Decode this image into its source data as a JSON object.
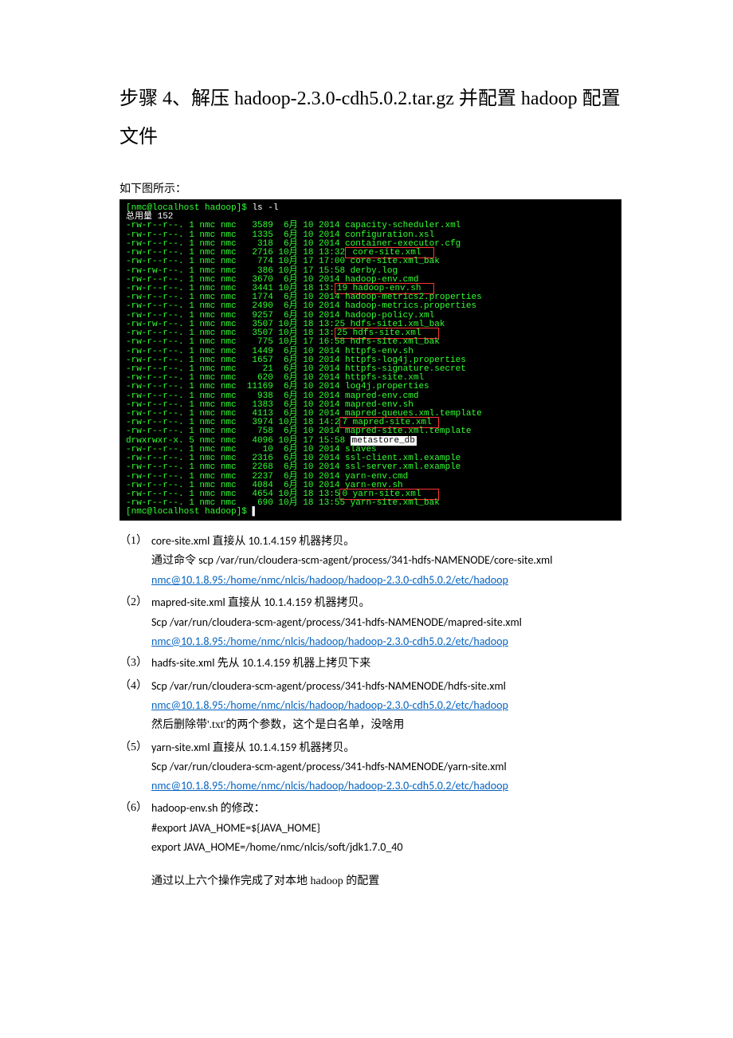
{
  "title": "步骤 4、解压 hadoop-2.3.0-cdh5.0.2.tar.gz  并配置 hadoop 配置文件",
  "intro": "如下图所示：",
  "terminal": {
    "line1a": "[nmc@localhost hadoop]$ ",
    "line1b": "ls -l",
    "total": "总用量 152",
    "rows_before_core": [
      "-rw-r--r--. 1 nmc nmc   3589  6月 10 2014 capacity-scheduler.xml",
      "-rw-r--r--. 1 nmc nmc   1335  6月 10 2014 configuration.xsl",
      "-rw-r--r--. 1 nmc nmc    318  6月 10 2014 container-executor.cfg"
    ],
    "core_prefix": "-rw-r--r--. 1 nmc nmc   2716 10月 18 13:32",
    "core_box": " core-site.xml  ",
    "rows_mid1": [
      "-rw-r--r--. 1 nmc nmc    774 10月 17 17:00 core-site.xml_bak",
      "-rw-rw-r--. 1 nmc nmc    386 10月 17 15:58 derby.log",
      "-rw-r--r--. 1 nmc nmc   3670  6月 10 2014 hadoop-env.cmd"
    ],
    "henv_prefix": "-rw-r--r--. 1 nmc nmc   3441 10月 18 13:",
    "henv_box": "19 hadoop-env.sh  ",
    "rows_mid2": [
      "-rw-r--r--. 1 nmc nmc   1774  6月 10 2014 hadoop-metrics2.properties",
      "-rw-r--r--. 1 nmc nmc   2490  6月 10 2014 hadoop-metrics.properties",
      "-rw-r--r--. 1 nmc nmc   9257  6月 10 2014 hadoop-policy.xml",
      "-rw-rw-r--. 1 nmc nmc   3507 10月 18 13:25 hdfs-site1.xml_bak"
    ],
    "hdfs_prefix": "-rw-r--r--. 1 nmc nmc   3507 10月 18 13:",
    "hdfs_box": "25 hdfs-site.xml   ",
    "rows_mid3": [
      "-rw-r--r--. 1 nmc nmc    775 10月 17 16:58 hdfs-site.xml_bak",
      "-rw-r--r--. 1 nmc nmc   1449  6月 10 2014 httpfs-env.sh",
      "-rw-r--r--. 1 nmc nmc   1657  6月 10 2014 httpfs-log4j.properties",
      "-rw-r--r--. 1 nmc nmc     21  6月 10 2014 httpfs-signature.secret",
      "-rw-r--r--. 1 nmc nmc    620  6月 10 2014 httpfs-site.xml",
      "-rw-r--r--. 1 nmc nmc  11169  6月 10 2014 log4j.properties",
      "-rw-r--r--. 1 nmc nmc    938  6月 10 2014 mapred-env.cmd",
      "-rw-r--r--. 1 nmc nmc   1383  6月 10 2014 mapred-env.sh",
      "-rw-r--r--. 1 nmc nmc   4113  6月 10 2014 mapred-queues.xml.template"
    ],
    "mapred_prefix": "-rw-r--r--. 1 nmc nmc   3974 10月 18 14:2",
    "mapred_box": "7 mapred-site.xml ",
    "row_mapred_after": "-rw-r--r--. 1 nmc nmc    758  6月 10 2014 mapred-site.xml.template",
    "meta_prefix": "drwxrwxr-x. 5 nmc nmc   4096 10月 17 15:58 ",
    "meta_box": "metastore_db",
    "rows_mid4": [
      "-rw-r--r--. 1 nmc nmc     10  6月 10 2014 slaves",
      "-rw-r--r--. 1 nmc nmc   2316  6月 10 2014 ssl-client.xml.example",
      "-rw-r--r--. 1 nmc nmc   2268  6月 10 2014 ssl-server.xml.example",
      "-rw-r--r--. 1 nmc nmc   2237  6月 10 2014 yarn-env.cmd",
      "-rw-r--r--. 1 nmc nmc   4084  6月 10 2014 yarn-env.sh"
    ],
    "yarn_prefix": "-rw-r--r--. 1 nmc nmc   4654 10月 18 13:5",
    "yarn_box": "0 yarn-site.xml   ",
    "row_last": "-rw-r--r--. 1 nmc nmc    690 10月 18 13:55 yarn-site.xml_bak",
    "prompt2": "[nmc@localhost hadoop]$ "
  },
  "items": [
    {
      "num": "（1）",
      "l1a": "core-site.xml ",
      "l1b": "直接从",
      "l1c": " 10.1.4.159 ",
      "l1d": "机器拷贝。",
      "l2a": "通过命令",
      "l2b": " scp   /var/run/cloudera-scm-agent/process/341-hdfs-NAMENODE/core-site.xml ",
      "link": "nmc@10.1.8.95:/home/nmc/nlcis/hadoop/hadoop-2.3.0-cdh5.0.2/etc/hadoop"
    },
    {
      "num": "（2）",
      "l1a": "mapred-site.xml  ",
      "l1b": "直接从",
      "l1c": " 10.1.4.159  ",
      "l1d": "机器拷贝。",
      "l2": " Scp   /var/run/cloudera-scm-agent/process/341-hdfs-NAMENODE/mapred-site.xml",
      "link": "nmc@10.1.8.95:/home/nmc/nlcis/hadoop/hadoop-2.3.0-cdh5.0.2/etc/hadoop"
    },
    {
      "num": "（3）",
      "l1a": "hadfs-site.xml  ",
      "l1b": "先从",
      "l1c": " 10.1.4.159 ",
      "l1d": "机器上拷贝下来"
    },
    {
      "num": "（4）",
      "l1a": "Scp   /var/run/cloudera-scm-agent/process/341-hdfs-NAMENODE/hdfs-site.xml",
      "link": "nmc@10.1.8.95:/home/nmc/nlcis/hadoop/hadoop-2.3.0-cdh5.0.2/etc/hadoop",
      "tail": "然后删除带'.txt'的两个参数，这个是白名单，没啥用"
    },
    {
      "num": "（5）",
      "l1a": "yarn-site.xml ",
      "l1b": "直接从",
      "l1c": " 10.1.4.159 ",
      "l1d": "机器拷贝。",
      "l2": "Scp   /var/run/cloudera-scm-agent/process/341-hdfs-NAMENODE/yarn-site.xml",
      "link": "nmc@10.1.8.95:/home/nmc/nlcis/hadoop/hadoop-2.3.0-cdh5.0.2/etc/hadoop"
    },
    {
      "num": "（6）",
      "l1a": "hadoop-env.sh ",
      "l1b": "的修改：",
      "l2": "#export JAVA_HOME=${JAVA_HOME}",
      "l3": "export JAVA_HOME=/home/nmc/nlcis/soft/jdk1.7.0_40"
    }
  ],
  "footer": "通过以上六个操作完成了对本地 hadoop 的配置"
}
